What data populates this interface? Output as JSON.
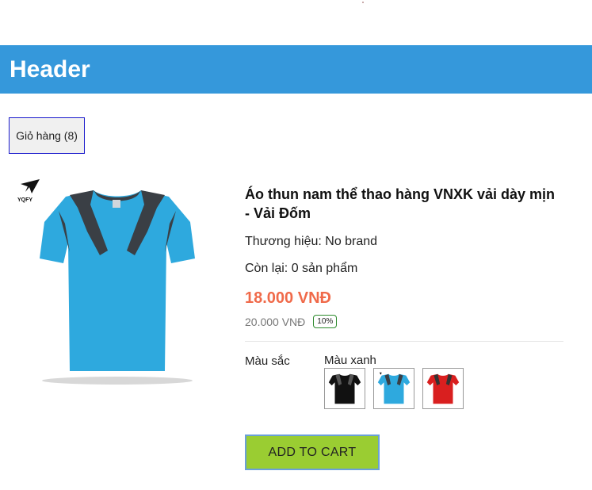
{
  "header": {
    "title": "Header"
  },
  "cart": {
    "label": "Giỏ hàng (8)"
  },
  "product": {
    "logo_text": "YQFY",
    "title": "Áo thun nam thể thao hàng VNXK vải dày mịn - Vải Đốm",
    "brand": "Thương hiệu: No brand",
    "stock": "Còn lại: 0 sản phẩm",
    "price": "18.000 VNĐ",
    "old_price": "20.000 VNĐ",
    "discount": "10%",
    "color_label": "Màu sắc",
    "color_selected": "Màu xanh",
    "swatches": [
      {
        "name": "black",
        "color": "#111111"
      },
      {
        "name": "blue",
        "color": "#2ea9de"
      },
      {
        "name": "red",
        "color": "#d91f1f"
      }
    ],
    "add_to_cart": "ADD TO CART"
  },
  "colors": {
    "header_bg": "#3598db",
    "price": "#f06a4a",
    "add_to_cart_bg": "#9acd32",
    "shirt_blue": "#2ea9de"
  }
}
